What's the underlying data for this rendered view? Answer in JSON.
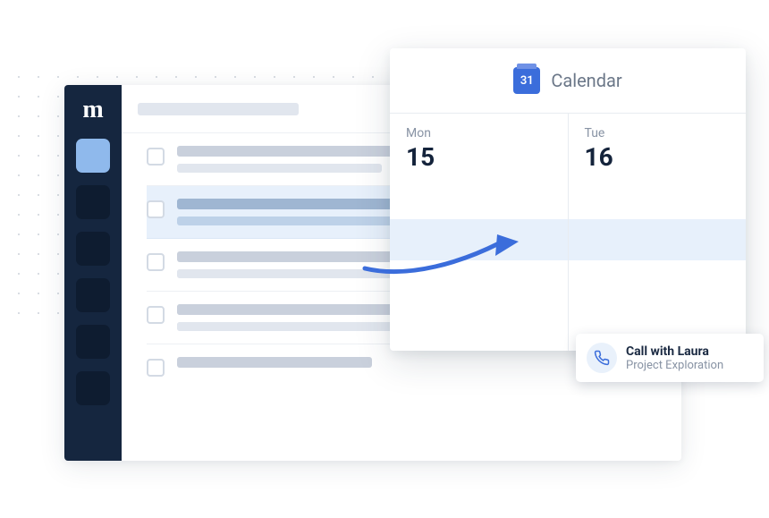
{
  "sidebar": {
    "logo": "m"
  },
  "calendar": {
    "title": "Calendar",
    "icon_day": "31",
    "days": [
      {
        "dow": "Mon",
        "num": "15"
      },
      {
        "dow": "Tue",
        "num": "16"
      }
    ]
  },
  "event": {
    "title": "Call with Laura",
    "subtitle": "Project Exploration"
  }
}
